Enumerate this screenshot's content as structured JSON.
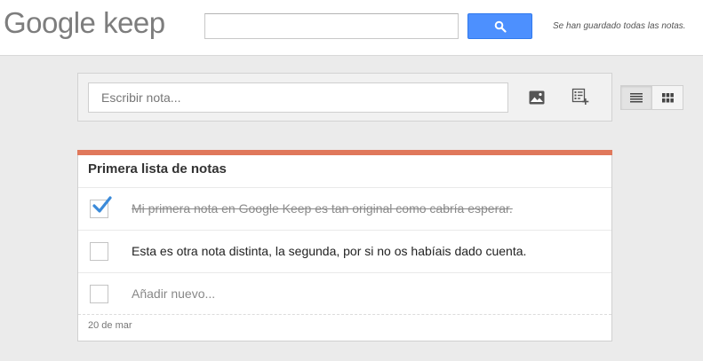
{
  "header": {
    "logo_text": "Google keep",
    "search": {
      "value": "",
      "placeholder": ""
    },
    "search_icon": "search-icon",
    "save_status": "Se han guardado todas las notas."
  },
  "composer": {
    "placeholder": "Escribir nota...",
    "image_icon": "image-icon",
    "list_icon": "new-list-icon"
  },
  "view_toggle": {
    "options": [
      "list-view-icon",
      "grid-view-icon"
    ],
    "selected": "list-view-icon"
  },
  "note": {
    "title": "Primera lista de notas",
    "items": [
      {
        "text": "Mi primera nota en Google Keep es tan original como cabría esperar.",
        "checked": true
      },
      {
        "text": "Esta es otra nota distinta, la segunda, por si no os habíais dado cuenta.",
        "checked": false
      },
      {
        "text": "Añadir nuevo...",
        "checked": false,
        "is_placeholder": true
      }
    ],
    "date": "20 de mar",
    "accent_color": "#e0785b"
  },
  "colors": {
    "search_button": "#4d90fe",
    "check_mark": "#3b8ad9",
    "background": "#ebebeb"
  }
}
